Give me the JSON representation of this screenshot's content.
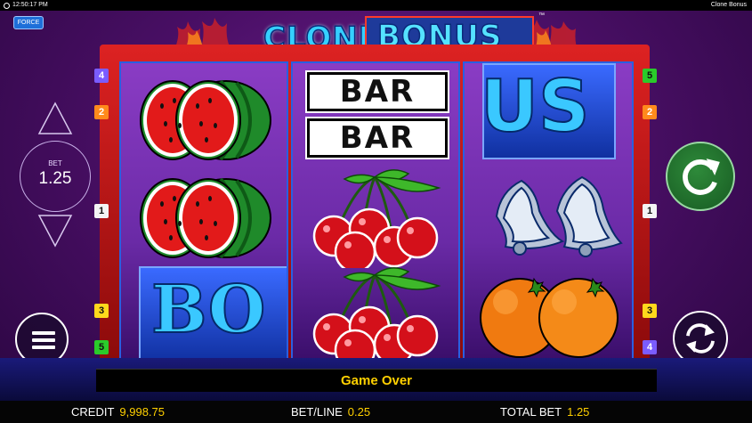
{
  "status_bar": {
    "time": "12:50:17 PM",
    "game_name": "Clone Bonus"
  },
  "force_button": {
    "label": "FORCE"
  },
  "logo": {
    "word1": "CLONE",
    "word2": "BONUS",
    "tm": "™"
  },
  "reels": [
    {
      "symbols": [
        "watermelon-icon",
        "watermelon-icon",
        "bonus-symbol-partial"
      ]
    },
    {
      "symbols": [
        "double-bar-icon",
        "cherries-icon",
        "cherries-icon"
      ]
    },
    {
      "symbols": [
        "bonus-symbol-partial",
        "bells-icon",
        "oranges-icon"
      ]
    }
  ],
  "symbol_text": {
    "bar": "BAR",
    "bonus_left": "BO",
    "bonus_right": "US"
  },
  "paylines": {
    "left": [
      "4",
      "2",
      "1",
      "3",
      "5"
    ],
    "right": [
      "5",
      "2",
      "1",
      "3",
      "4"
    ]
  },
  "bet": {
    "label": "BET",
    "value": "1.25"
  },
  "message": "Game Over",
  "info": {
    "credit_label": "CREDIT",
    "credit_value": "9,998.75",
    "betline_label": "BET/LINE",
    "betline_value": "0.25",
    "totalbet_label": "TOTAL BET",
    "totalbet_value": "1.25"
  },
  "colors": {
    "accent_yellow": "#ffd000",
    "spin_green": "#1f6e2c",
    "reel_border": "#2a5fe0"
  }
}
